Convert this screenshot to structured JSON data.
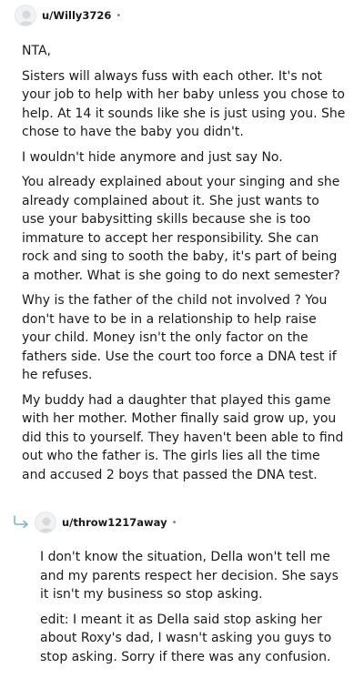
{
  "comments": [
    {
      "username": "u/Willy3726",
      "separator": "•",
      "paragraphs": [
        "NTA,",
        "Sisters will always fuss with each other. It's not your job to help with her baby unless you chose to help. At 14 it sounds like she is just using you. She chose to have the baby you didn't.",
        "I wouldn't hide anymore and just say No.",
        "You already explained about your singing and she already complained about it. She just wants to use your babysitting skills because she is too immature to accept her responsibility. She can rock and sing to sooth the baby, it's part of being a mother. What is she going to do next semester?",
        "Why is the father of the child not involved ? You don't have to be in a relationship to help raise your child. Money isn't the only factor on the fathers side. Use the court too force a DNA test if he refuses.",
        "My buddy had a daughter that played this game with her mother. Mother finally said grow up, you did this to yourself. They haven't been able to find out who the father is. The girls lies all the time and accused 2 boys that passed the DNA test."
      ]
    },
    {
      "username": "u/throw1217away",
      "separator": "•",
      "paragraphs": [
        "I don't know the situation, Della won't tell me and my parents respect her decision. She says it isn't my business so stop asking.",
        "edit: I meant it as Della said stop asking her about Roxy's dad, I wasn't asking you guys to stop asking. Sorry if there was any confusion."
      ]
    }
  ],
  "icons": {
    "avatar": "avatar-icon",
    "reply": "reply-arrow-icon"
  },
  "colors": {
    "text": "#1a1a1b",
    "meta": "#7c7c7c",
    "reply_arrow": "#7fb2d9",
    "avatar_bg": "#f1f2f3"
  }
}
